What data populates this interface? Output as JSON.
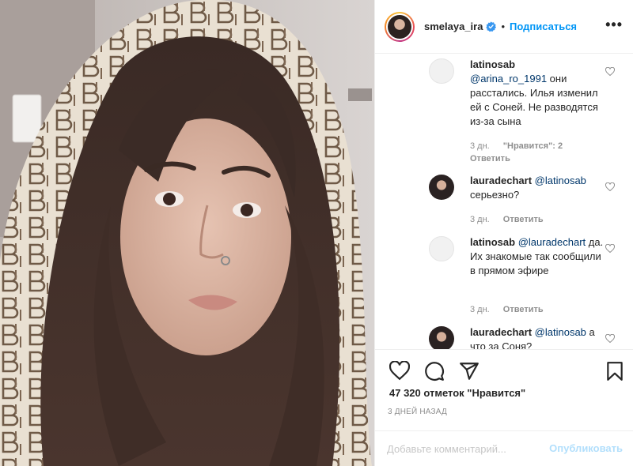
{
  "post": {
    "username": "smelaya_ira",
    "separator": "•",
    "follow_label": "Подписаться",
    "more_label": "•••"
  },
  "comments": [
    {
      "user": "latinosab",
      "mention": "@arina_ro_1991",
      "text": " они расстались. Илья изменил ей с Соней. Не разводятся из-за сына",
      "time": "3 дн.",
      "likes": "\"Нравится\": 2",
      "reply": "Ответить"
    },
    {
      "user": "lauradechart",
      "mention": "@latinosab",
      "text": " серьезно?",
      "time": "3 дн.",
      "reply": "Ответить"
    },
    {
      "user": "latinosab",
      "mention": "@lauradechart",
      "text": " да. Их знакомые так сообщили в прямом эфире",
      "time": "3 дн.",
      "reply": "Ответить"
    },
    {
      "user": "lauradechart",
      "mention": "@latinosab",
      "text": " а что за Соня?"
    }
  ],
  "footer": {
    "likes_count": "47 320 отметок \"Нравится\"",
    "date": "3 ДНЕЙ НАЗАД",
    "comment_placeholder": "Добавьте комментарий...",
    "publish_label": "Опубликовать"
  },
  "icons": {
    "like": "heart-icon",
    "comment": "comment-icon",
    "share": "share-icon",
    "save": "bookmark-icon",
    "verified": "verified-badge-icon"
  },
  "colors": {
    "accent": "#0095f6",
    "mention": "#00376b",
    "muted": "#8e8e8e",
    "publish_disabled": "#b2dffc"
  }
}
